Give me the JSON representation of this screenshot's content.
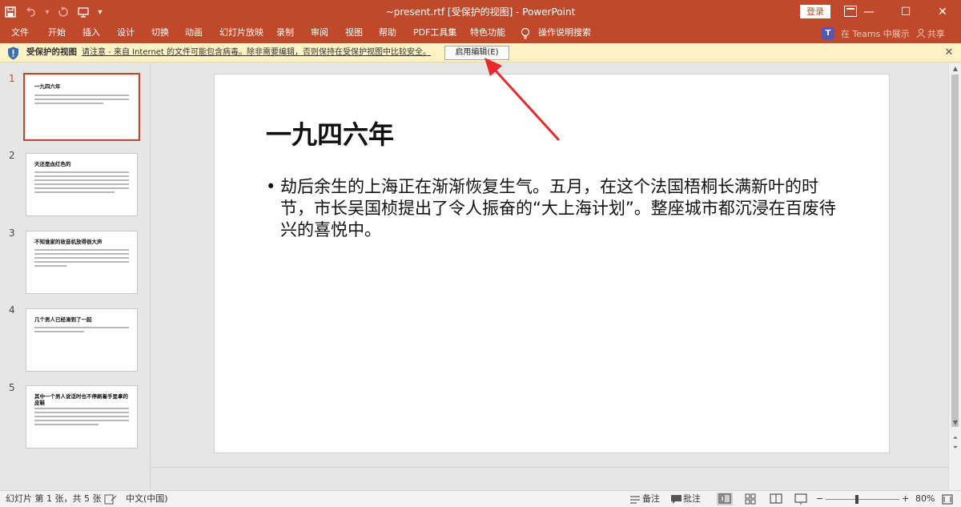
{
  "titlebar": {
    "save_icon": "save-icon",
    "undo_icon": "undo-icon",
    "redo_icon": "redo-icon",
    "start_from_beginning_icon": "slideshow-start-icon",
    "customize_icon": "customize-qat-icon",
    "title": "~present.rtf  [受保护的视图]  -  PowerPoint",
    "login_label": "登录",
    "background": "#c1492b"
  },
  "ribbon": {
    "tabs": [
      "文件",
      "开始",
      "插入",
      "设计",
      "切换",
      "动画",
      "幻灯片放映",
      "录制",
      "审阅",
      "视图",
      "帮助",
      "PDF工具集",
      "特色功能"
    ],
    "tell_me": "操作说明搜索",
    "teams_label": "在 Teams 中展示",
    "share_label": "共享"
  },
  "protected_view": {
    "title": "受保护的视图",
    "message": "请注意 - 来自 Internet 的文件可能包含病毒。除非需要编辑，否则保持在受保护视图中比较安全。",
    "enable_button": "启用编辑(E)",
    "background": "#fff3c5"
  },
  "thumbnails": [
    {
      "num": "1",
      "title": "一九四六年",
      "active": true
    },
    {
      "num": "2",
      "title": "天还是血红色的"
    },
    {
      "num": "3",
      "title": "不知谁家的收音机放得很大声"
    },
    {
      "num": "4",
      "title": "几个男人已经凑到了一起"
    },
    {
      "num": "5",
      "title": "其中一个男人说话时也不停刷着手里拿的皮鞋"
    }
  ],
  "slide": {
    "title": "一九四六年",
    "bullet": "•",
    "body": "劫后余生的上海正在渐渐恢复生气。五月，在这个法国梧桐长满新叶的时节，市长吴国桢提出了令人振奋的“大上海计划”。整座城市都沉浸在百废待兴的喜悦中。"
  },
  "statusbar": {
    "slide_info": "幻灯片 第 1 张，共 5 张",
    "language": "中文(中国)",
    "notes_label": "备注",
    "comments_label": "批注",
    "zoom_minus": "−",
    "zoom_plus": "+",
    "zoom": "80%"
  }
}
